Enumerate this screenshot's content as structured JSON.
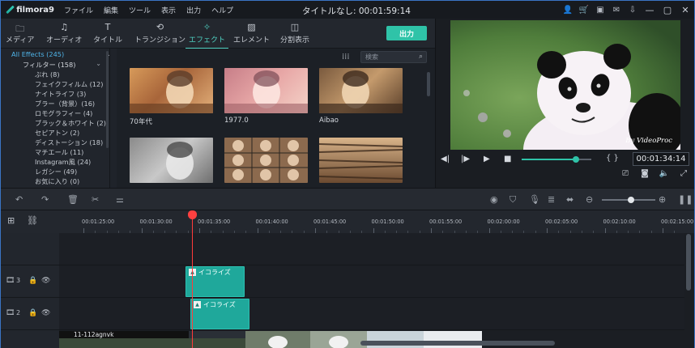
{
  "app": {
    "name": "filmora9",
    "menu": [
      "ファイル",
      "編集",
      "ツール",
      "表示",
      "出力",
      "ヘルプ"
    ],
    "title": "タイトルなし: 00:01:59:14"
  },
  "tabs": [
    {
      "label": "メディア",
      "icon": "folder-icon"
    },
    {
      "label": "オーディオ",
      "icon": "music-note-icon"
    },
    {
      "label": "タイトル",
      "icon": "text-icon"
    },
    {
      "label": "トランジション",
      "icon": "transition-icon"
    },
    {
      "label": "エフェクト",
      "icon": "effects-icon",
      "active": true
    },
    {
      "label": "エレメント",
      "icon": "image-icon"
    },
    {
      "label": "分割表示",
      "icon": "split-screen-icon"
    }
  ],
  "export_label": "出力",
  "tree": {
    "root": "All Effects (245)",
    "filter": "フィルター (158)",
    "items": [
      "ぶれ (8)",
      "フェイクフィルム (12)",
      "ナイトライフ (3)",
      "ブラー（背景）(16)",
      "ロモグラフィー (4)",
      "ブラック＆ホワイト (2)",
      "セピアトン (2)",
      "ディストーション (18)",
      "マチエール (11)",
      "Instagram風 (24)",
      "レガシー (49)",
      "お気に入り (0)"
    ]
  },
  "search": {
    "placeholder": "検索"
  },
  "effects": [
    {
      "label": "70年代"
    },
    {
      "label": "1977.0"
    },
    {
      "label": "Aibao"
    },
    {
      "label": ""
    },
    {
      "label": ""
    },
    {
      "label": ""
    }
  ],
  "preview": {
    "watermark": "By VideoProc",
    "time": "00:01:34:14",
    "progress": 0.78
  },
  "timeline": {
    "ruler_labels": [
      "00:01:25:00",
      "00:01:30:00",
      "00:01:35:00",
      "00:01:40:00",
      "00:01:45:00",
      "00:01:50:00",
      "00:01:55:00",
      "00:02:00:00",
      "00:02:05:00",
      "00:02:10:00",
      "00:02:15:00"
    ],
    "tracks": [
      {
        "number": "3",
        "clip_label": "イコライズ"
      },
      {
        "number": "2",
        "clip_label": "イコライズ"
      }
    ],
    "video_clip_label": "11-112agnvk",
    "zoom": 0.55
  },
  "colors": {
    "accent": "#2fc3a8",
    "playhead": "#ff3b3b",
    "clip": "#1fa89b"
  }
}
